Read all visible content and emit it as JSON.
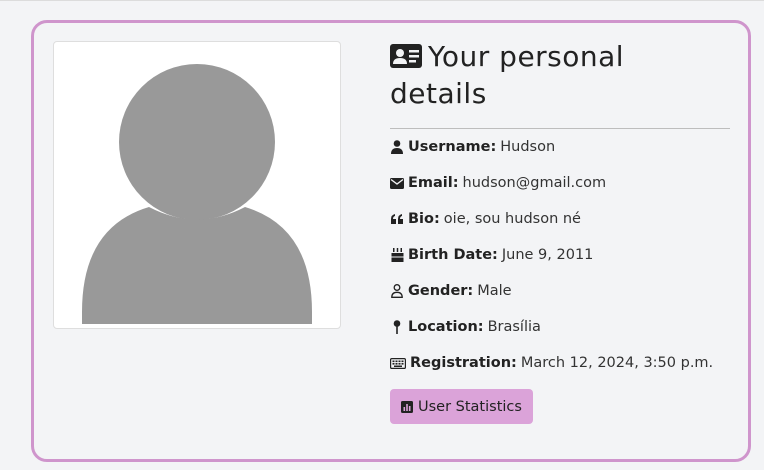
{
  "profile": {
    "title": "Your personal details",
    "fields": [
      {
        "icon": "user-icon",
        "label": "Username:",
        "value": "Hudson"
      },
      {
        "icon": "envelope-icon",
        "label": "Email:",
        "value": "hudson@gmail.com"
      },
      {
        "icon": "quote-icon",
        "label": "Bio:",
        "value": "oie, sou hudson né"
      },
      {
        "icon": "cake-icon",
        "label": "Birth Date:",
        "value": "June 9, 2011"
      },
      {
        "icon": "person-outline-icon",
        "label": "Gender:",
        "value": "Male"
      },
      {
        "icon": "pin-icon",
        "label": "Location:",
        "value": "Brasília"
      },
      {
        "icon": "keyboard-icon",
        "label": "Registration:",
        "value": "March 12, 2024, 3:50 p.m."
      }
    ],
    "stats_button": "User Statistics"
  },
  "colors": {
    "card_border": "#cf95cc",
    "button_bg": "#dba3d9",
    "avatar_fill": "#999999"
  }
}
